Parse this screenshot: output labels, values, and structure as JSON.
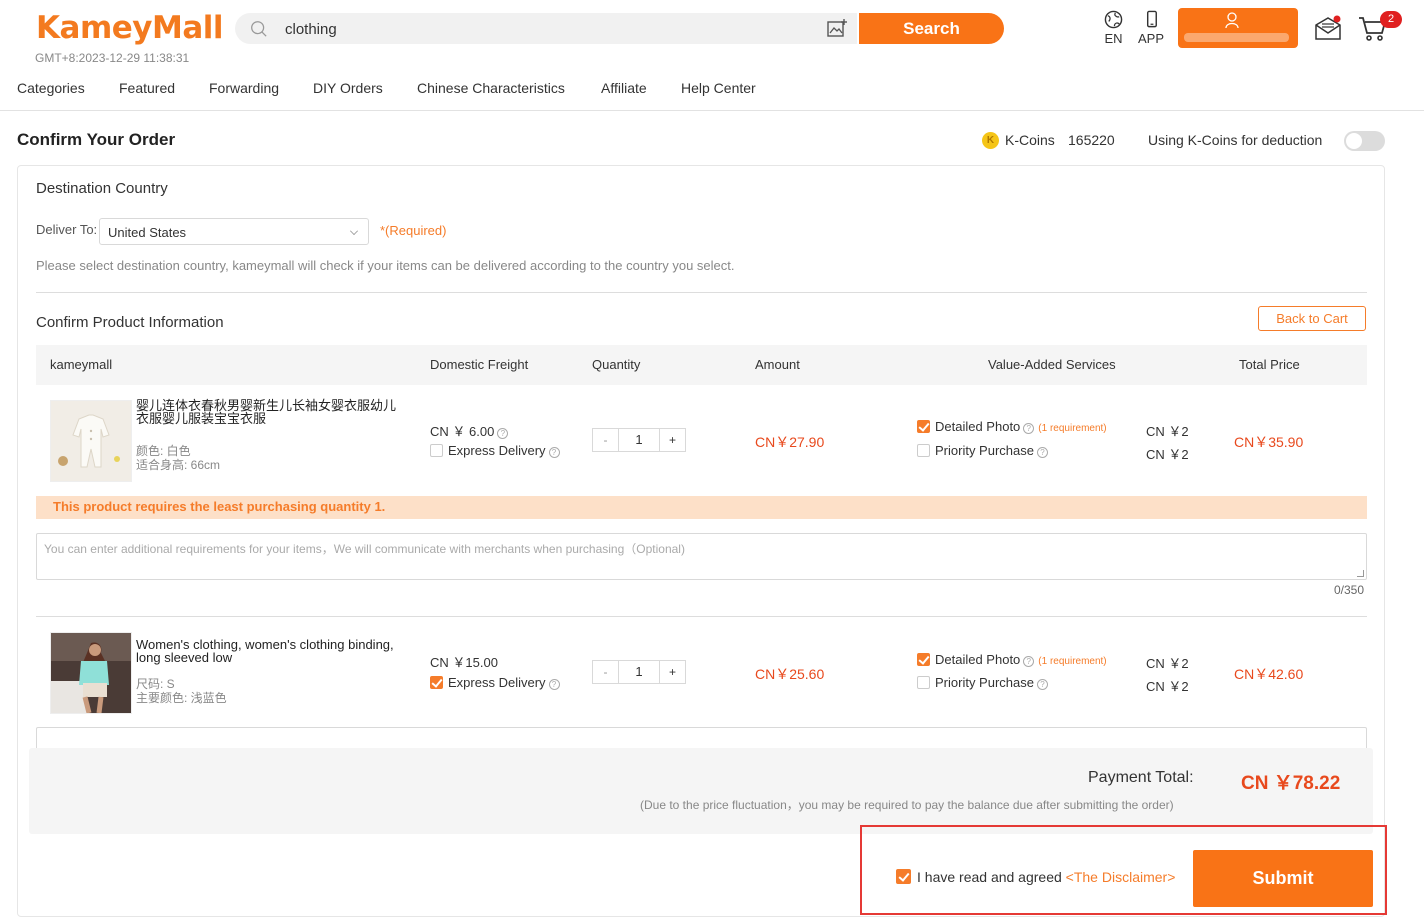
{
  "header": {
    "logo": "KameyMall",
    "clock": "GMT+8:2023-12-29 11:38:31",
    "search_value": "clothing",
    "search_button": "Search",
    "lang_label": "EN",
    "app_label": "APP",
    "cart_count": "2",
    "accent_color": "#f97316"
  },
  "nav": [
    "Categories",
    "Featured",
    "Forwarding",
    "DIY Orders",
    "Chinese Characteristics",
    "Affiliate",
    "Help Center"
  ],
  "order": {
    "title": "Confirm Your Order",
    "kcoin_icon": "K",
    "kcoin_label": "K-Coins",
    "kcoin_value": "165220",
    "kcoin_deduct_label": "Using K-Coins for deduction",
    "kcoin_deduct_on": false
  },
  "destination": {
    "title": "Destination Country",
    "deliver_label": "Deliver To:",
    "country": "United States",
    "required": "*(Required)",
    "hint": "Please select destination country, kameymall will check if your items can be delivered according to the country you select."
  },
  "products": {
    "title": "Confirm Product Information",
    "back_to_cart": "Back to Cart",
    "columns": [
      "kameymall",
      "Domestic Freight",
      "Quantity",
      "Amount",
      "Value-Added Services",
      "Total Price"
    ],
    "minus": "-",
    "plus": "+",
    "express_label": "Express Delivery",
    "detailed_photo_label": "Detailed Photo",
    "requirement_note": "(1 requirement)",
    "priority_label": "Priority Purchase",
    "items": [
      {
        "name": "婴儿连体衣春秋男婴新生儿长袖女婴衣服幼儿衣服婴儿服装宝宝衣服",
        "attr1": "颜色: 白色",
        "attr2": "适合身高: 66cm",
        "freight": "CN ￥ 6.00",
        "express_checked": false,
        "quantity": "1",
        "amount": "CN￥27.90",
        "detailed_photo_checked": true,
        "priority_checked": false,
        "detailed_photo_price": "CN ￥2",
        "priority_price": "CN ￥2",
        "total": "CN￥35.90"
      },
      {
        "name": "Women's clothing, women's clothing binding, long sleeved low",
        "attr1": "尺码: S",
        "attr2": "主要颜色: 浅蓝色",
        "freight": "CN ￥15.00",
        "express_checked": true,
        "quantity": "1",
        "amount": "CN￥25.60",
        "detailed_photo_checked": true,
        "priority_checked": false,
        "detailed_photo_price": "CN ￥2",
        "priority_price": "CN ￥2",
        "total": "CN￥42.60"
      }
    ],
    "min_qty_warning": "This product requires the least purchasing quantity 1.",
    "requirements_placeholder": "You can enter additional requirements for your items，We will communicate with merchants when purchasing（Optional)",
    "char_counter": "0/350"
  },
  "summary": {
    "payment_label": "Payment Total:",
    "payment_value": "CN ￥78.22",
    "note": "(Due to the price fluctuation，you may be required to pay the balance due after submitting the order)",
    "agree_text": "I have read and agreed",
    "disclaimer": "<The Disclaimer>",
    "agree_checked": true,
    "submit": "Submit"
  }
}
